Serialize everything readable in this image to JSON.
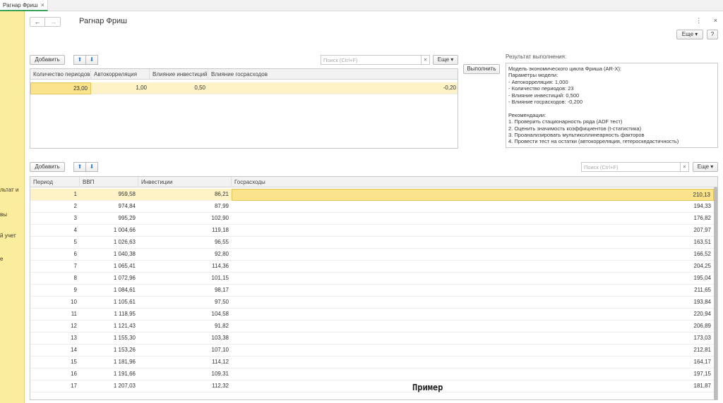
{
  "tab": {
    "label": "Рагнар Фриш",
    "close": "×"
  },
  "left_panel": {
    "items": [
      "льтат и",
      "вы",
      "й учет",
      "е"
    ]
  },
  "window": {
    "title": "Рагнар Фриш",
    "back": "←",
    "forward": "→",
    "more": "⋮",
    "close": "×"
  },
  "top_more": {
    "label": "Еще ▾",
    "help": "?"
  },
  "params_toolbar": {
    "add": "Добавить",
    "up": "⬆",
    "down": "⬇",
    "search_placeholder": "Поиск (Ctrl+F)",
    "search_clear": "×",
    "more": "Еще ▾"
  },
  "params_table": {
    "headers": [
      "Количество периодов",
      "Автокорреляция",
      "Влияние инвестиций",
      "Влияние госрасходов"
    ],
    "rows": [
      [
        "23,00",
        "1,00",
        "0,50",
        "-0,20"
      ]
    ]
  },
  "execute_button": "Выполнить",
  "result": {
    "label": "Результат выполнения:",
    "text": "Модель экономического цикла Фриша (AR-X):\nПараметры модели:\n- Автокорреляция: 1,000\n- Количество периодов: 23\n- Влияние инвестиций: 0,500\n- Влияние госрасходов: -0,200\n\nРекомендации:\n1. Проверить стационарность ряда (ADF тест)\n2. Оценить значимость коэффициентов (t-статистика)\n3. Проанализировать мультиколлинеарность факторов\n4. Провести тест на остатки (автокорреляция, гетероскедастичность)"
  },
  "data_toolbar": {
    "add": "Добавить",
    "up": "⬆",
    "down": "⬇",
    "search_placeholder": "Поиск (Ctrl+F)",
    "search_clear": "×",
    "more": "Еще ▾"
  },
  "data_table": {
    "headers": [
      "Период",
      "ВВП",
      "Инвестиции",
      "Госрасходы"
    ],
    "rows": [
      [
        "1",
        "959,58",
        "86,21",
        "210,13"
      ],
      [
        "2",
        "974,84",
        "87,99",
        "194,33"
      ],
      [
        "3",
        "995,29",
        "102,90",
        "176,82"
      ],
      [
        "4",
        "1 004,66",
        "119,18",
        "207,97"
      ],
      [
        "5",
        "1 026,63",
        "96,55",
        "163,51"
      ],
      [
        "6",
        "1 040,38",
        "92,80",
        "166,52"
      ],
      [
        "7",
        "1 065,41",
        "114,36",
        "204,25"
      ],
      [
        "8",
        "1 072,96",
        "101,15",
        "195,04"
      ],
      [
        "9",
        "1 084,61",
        "98,17",
        "211,65"
      ],
      [
        "10",
        "1 105,61",
        "97,50",
        "193,84"
      ],
      [
        "11",
        "1 118,95",
        "104,58",
        "220,94"
      ],
      [
        "12",
        "1 121,43",
        "91,82",
        "206,89"
      ],
      [
        "13",
        "1 155,30",
        "103,38",
        "173,03"
      ],
      [
        "14",
        "1 153,26",
        "107,10",
        "212,81"
      ],
      [
        "15",
        "1 181,96",
        "114,12",
        "164,17"
      ],
      [
        "16",
        "1 191,66",
        "109,31",
        "197,15"
      ],
      [
        "17",
        "1 207,03",
        "112,32",
        "181,87"
      ]
    ]
  },
  "watermark": "Пример"
}
